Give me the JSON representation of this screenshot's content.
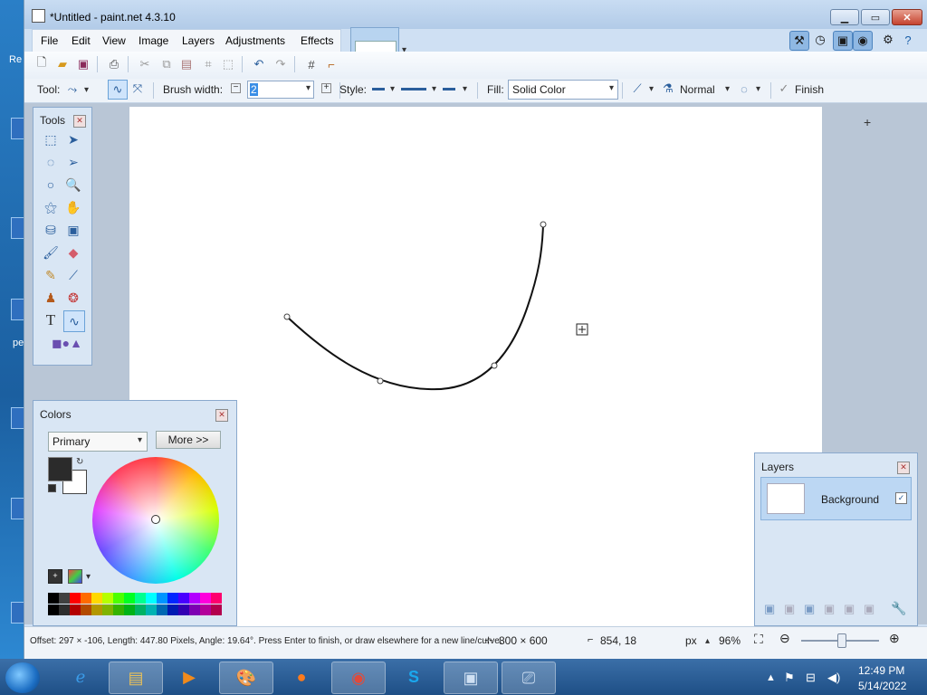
{
  "window": {
    "title": "*Untitled - paint.net 4.3.10",
    "minimize_glyph": "▁",
    "maximize_glyph": "▭",
    "close_glyph": "✕"
  },
  "menu": {
    "items": [
      "File",
      "Edit",
      "View",
      "Image",
      "Layers",
      "Adjustments",
      "Effects"
    ]
  },
  "toolbar": {
    "tool_label": "Tool:",
    "brush_width_label": "Brush width:",
    "brush_width_value": "2",
    "style_label": "Style:",
    "fill_label": "Fill:",
    "fill_value": "Solid Color",
    "blend_value": "Normal",
    "finish_label": "Finish"
  },
  "tools_panel": {
    "title": "Tools",
    "icons": [
      "rectangle-select-icon",
      "move-selection-icon",
      "lasso-select-icon",
      "move-selected-icon",
      "ellipse-select-icon",
      "zoom-icon",
      "magic-wand-icon",
      "pan-icon",
      "paint-bucket-icon",
      "gradient-icon",
      "paintbrush-icon",
      "eraser-icon",
      "pencil-icon",
      "color-picker-icon",
      "clone-stamp-icon",
      "recolor-icon",
      "text-icon",
      "line-curve-icon",
      "shapes-icon"
    ],
    "selected_icon": "line-curve-icon"
  },
  "colors_panel": {
    "title": "Colors",
    "mode_value": "Primary",
    "more_label": "More >>",
    "primary_color": "#2b2b2b",
    "secondary_color": "#ffffff",
    "palette": [
      "#000000",
      "#404040",
      "#ff0000",
      "#ff6a00",
      "#ffd800",
      "#b6ff00",
      "#4cff00",
      "#00ff21",
      "#00ff90",
      "#00ffff",
      "#0094ff",
      "#0026ff",
      "#4800ff",
      "#b200ff",
      "#ff00dc",
      "#ff006e"
    ]
  },
  "layers_panel": {
    "title": "Layers",
    "layer_name": "Background",
    "layer_visible": true
  },
  "status": {
    "message": "Offset: 297 × -106, Length: 447.80 Pixels, Angle: 19.64°. Press Enter to finish, or draw elsewhere for a new line/curve.",
    "image_size": "800 × 600",
    "cursor_pos": "854, 18",
    "units": "px",
    "zoom": "96%"
  },
  "taskbar": {
    "time": "12:49 PM",
    "date": "5/14/2022"
  },
  "desktop": {
    "label_re": "Re",
    "label_pe": "pe"
  },
  "colors": {
    "accent": "#1d6fb8",
    "selection": "#cfe4fb"
  }
}
